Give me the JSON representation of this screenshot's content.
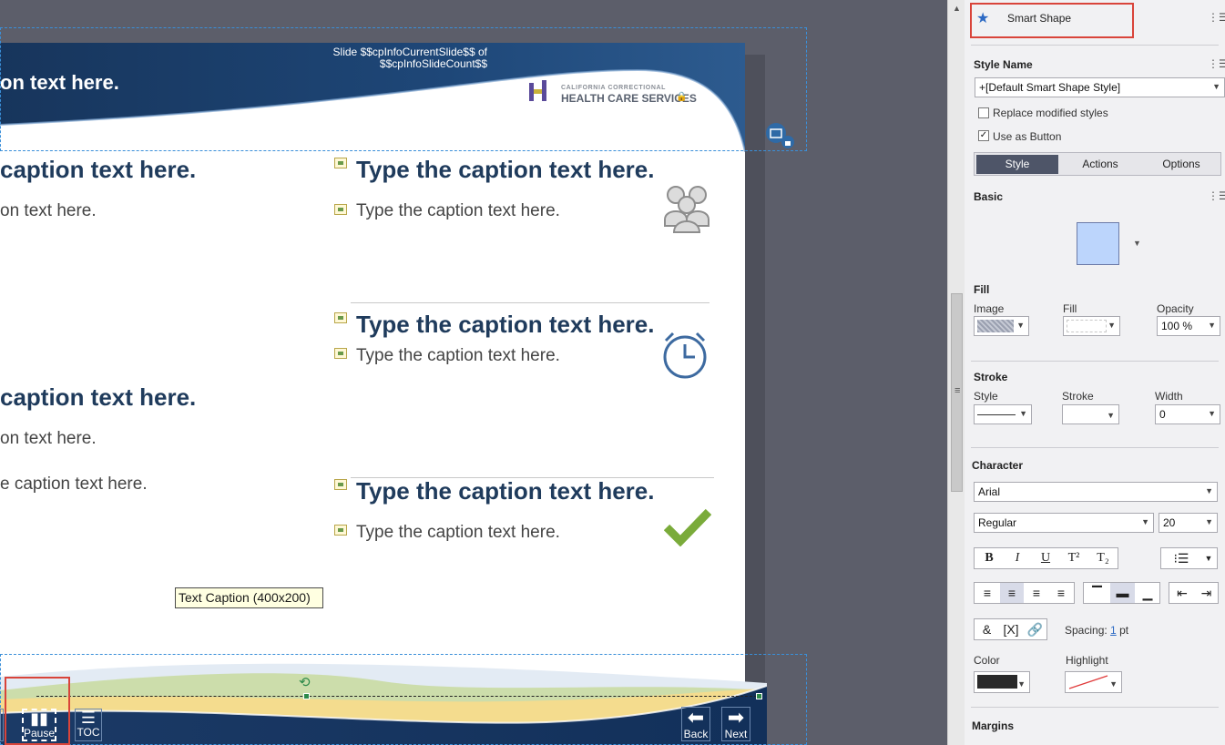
{
  "slide": {
    "header_title": "on text here.",
    "slide_counter_line1": "Slide $$cpInfoCurrentSlide$$ of",
    "slide_counter_line2": "$$cpInfoSlideCount$$",
    "logo_line1": "CALIFORNIA CORRECTIONAL",
    "logo_line2": "HEALTH CARE SERVICES"
  },
  "captions": {
    "left_heading_1": "caption text here.",
    "left_body_1": "on text here.",
    "left_heading_2": "caption text here.",
    "left_body_2": "on text here.",
    "left_body_3": "e caption text here.",
    "right_heading_1": "Type the caption text here.",
    "right_body_1": "Type the caption text here.",
    "right_heading_2": "Type the caption text here.",
    "right_body_2": "Type the caption text here.",
    "right_heading_3": "Type the caption text here.",
    "right_body_3": "Type the caption text here."
  },
  "tooltip": "Text Caption  (400x200)",
  "footer": {
    "pause_label": "Pause",
    "toc_label": "TOC",
    "back_label": "Back",
    "next_label": "Next"
  },
  "panel": {
    "object_type": "Smart Shape",
    "style_name_label": "Style Name",
    "style_name_value": "+[Default Smart Shape Style]",
    "replace_modified_styles": "Replace modified styles",
    "use_as_button": "Use as Button",
    "use_as_button_checked": true,
    "tabs": [
      "Style",
      "Actions",
      "Options"
    ],
    "active_tab": "Style",
    "basic_label": "Basic",
    "shape_color": "#bcd5fc",
    "fill_label": "Fill",
    "fill_image_label": "Image",
    "fill_fill_label": "Fill",
    "fill_opacity_label": "Opacity",
    "opacity_value": "100 %",
    "stroke_label": "Stroke",
    "stroke_style_label": "Style",
    "stroke_stroke_label": "Stroke",
    "stroke_width_label": "Width",
    "stroke_width_value": "0",
    "character_label": "Character",
    "font_family": "Arial",
    "font_style": "Regular",
    "font_size": "20",
    "spacing_label": "Spacing:",
    "spacing_value": "1",
    "spacing_unit": "pt",
    "color_label": "Color",
    "highlight_label": "Highlight",
    "text_color": "#2a2a2a",
    "margins_label": "Margins"
  },
  "colors": {
    "header_blue": "#1d3a63",
    "heading_text": "#1f3b5c",
    "selection_red": "#d9443a",
    "accent_green": "#7aab3a"
  }
}
